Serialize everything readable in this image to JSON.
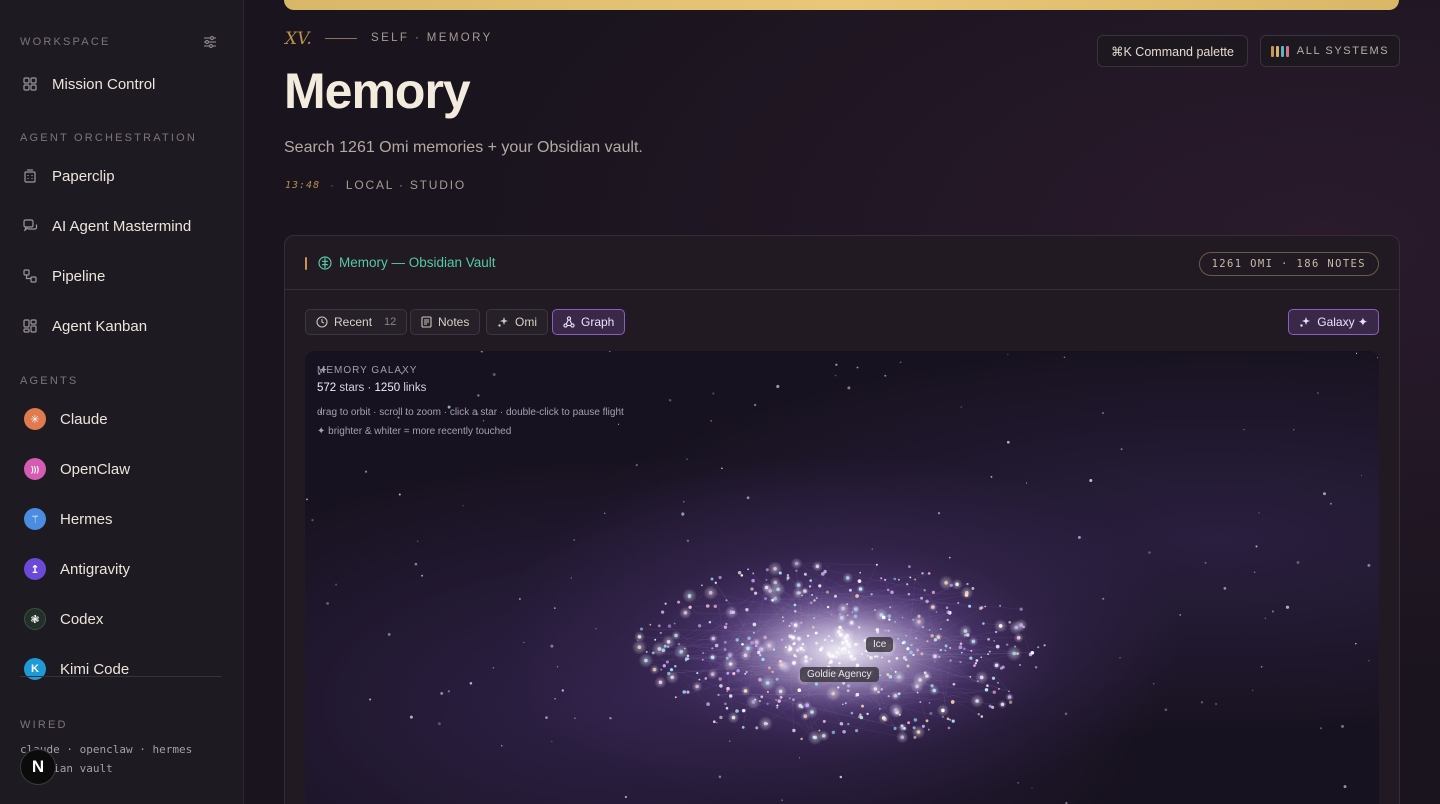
{
  "sidebar": {
    "workspace_label": "WORKSPACE",
    "mission_control": "Mission Control",
    "orchestration_label": "AGENT ORCHESTRATION",
    "orchestration_items": [
      "Paperclip",
      "AI Agent Mastermind",
      "Pipeline",
      "Agent Kanban"
    ],
    "agents_label": "AGENTS",
    "agents": [
      {
        "name": "Claude",
        "color": "#e07a4f",
        "glyph": "✳"
      },
      {
        "name": "OpenClaw",
        "color": "#d65bb3",
        "glyph": ")))"
      },
      {
        "name": "Hermes",
        "color": "#4a8de0",
        "glyph": "⚚"
      },
      {
        "name": "Antigravity",
        "color": "#6a4ad6",
        "glyph": "↥"
      },
      {
        "name": "Codex",
        "color": "#22302a",
        "glyph": "❃"
      },
      {
        "name": "Kimi Code",
        "color": "#1e9ad6",
        "glyph": "K"
      }
    ],
    "wired_label": "WIRED",
    "wired_line1": "claude · openclaw · hermes",
    "wired_line2": "obsidian vault",
    "badge": "N"
  },
  "header": {
    "numeral": "XV.",
    "eyebrow": "SELF · MEMORY",
    "title": "Memory",
    "subtitle": "Search 1261 Omi memories + your Obsidian vault.",
    "time": "13:48",
    "location": "LOCAL · STUDIO",
    "command_palette": "⌘K  Command palette",
    "all_systems": "ALL SYSTEMS",
    "system_colors": [
      "#c9944f",
      "#d8b06a",
      "#5fb0c9",
      "#c97a8a"
    ]
  },
  "panel": {
    "title": "Memory — Obsidian Vault",
    "badge": "1261 OMI · 186 NOTES",
    "tabs": [
      {
        "label": "Recent",
        "count": "12"
      },
      {
        "label": "Notes"
      },
      {
        "label": "Omi"
      },
      {
        "label": "Graph"
      }
    ],
    "active_tab": "Graph",
    "galaxy_button": "Galaxy ✦"
  },
  "galaxy": {
    "label": "MEMORY GALAXY",
    "stars": "572",
    "stars_suffix": " stars · ",
    "links": "1250",
    "links_suffix": " links",
    "hint1": "drag to orbit · scroll to zoom · click a star · double-click to pause flight",
    "hint2": "✦ brighter & whiter = more recently touched",
    "tag_ice": "Ice",
    "tag_goldie": "Goldie Agency"
  }
}
